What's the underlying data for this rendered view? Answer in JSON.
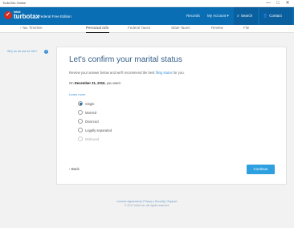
{
  "window": {
    "title": "TurboTax Online",
    "minimize_glyph": "—",
    "maximize_glyph": "□",
    "close_glyph": "✕"
  },
  "header": {
    "logo": {
      "mark": "✓",
      "company": "intuit",
      "brand": "turbotax",
      "edition": "Federal Free Edition"
    },
    "links": {
      "records": "Records",
      "account": "My Account ▾"
    },
    "search": {
      "label": "Search",
      "icon": "search-icon",
      "glyph": "⌕"
    },
    "contact": {
      "label": "Contact",
      "icon": "person-icon",
      "glyph": "👤"
    }
  },
  "nav": {
    "back": "‹  Tax Timeline",
    "tabs": [
      {
        "label": "Personal info",
        "active": true
      },
      {
        "label": "Federal Taxes",
        "active": false
      },
      {
        "label": "State Taxes",
        "active": false
      },
      {
        "label": "Review",
        "active": false
      },
      {
        "label": "File",
        "active": false
      }
    ]
  },
  "side": {
    "help": "Why do we ask for this?",
    "help_glyph": "i"
  },
  "main": {
    "title": "Let's confirm your marital status",
    "intro_pre": "Review your answer below and we'll recommend the best ",
    "intro_link": "filing status",
    "intro_post": " for you.",
    "date_pre": "On ",
    "date_bold": "December 31, 2016",
    "date_post": ", you were:",
    "learn_more": "Learn more",
    "options": [
      {
        "label": "Single",
        "selected": true
      },
      {
        "label": "Married",
        "selected": false
      },
      {
        "label": "Divorced",
        "selected": false
      },
      {
        "label": "Legally separated",
        "selected": false
      },
      {
        "label": "Widowed",
        "selected": false
      }
    ],
    "back": "‹ Back",
    "continue": "Continue"
  },
  "footer": {
    "links": "License Agreement | Privacy | Security | Support",
    "copyright": "© 2017 Intuit Inc. All rights reserved."
  },
  "colors": {
    "header_blue": "#0a6eb4",
    "title_blue": "#355f8a",
    "continue_blue": "#2ea0e0",
    "logo_red": "#d52b1e"
  }
}
